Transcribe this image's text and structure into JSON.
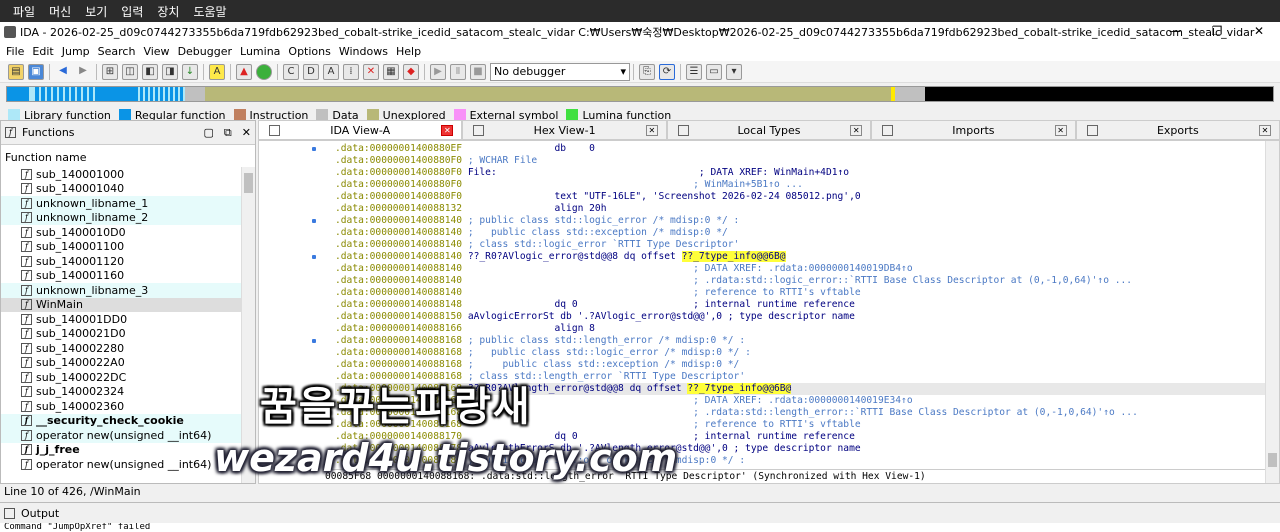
{
  "os_menu": [
    "파일",
    "머신",
    "보기",
    "입력",
    "장치",
    "도움말"
  ],
  "title": "IDA - 2026-02-25_d09c0744273355b6da719fdb62923bed_cobalt-strike_icedid_satacom_stealc_vidar C:₩Users₩숙정₩Desktop₩2026-02-25_d09c0744273355b6da719fdb62923bed_cobalt-strike_icedid_satacom_stealc_vidar",
  "menu": [
    "File",
    "Edit",
    "Jump",
    "Search",
    "View",
    "Debugger",
    "Lumina",
    "Options",
    "Windows",
    "Help"
  ],
  "debugger": "No debugger",
  "legend": [
    {
      "label": "Library function",
      "color": "#aee8f8"
    },
    {
      "label": "Regular function",
      "color": "#0a94e6"
    },
    {
      "label": "Instruction",
      "color": "#c08060"
    },
    {
      "label": "Data",
      "color": "#c0c0c0"
    },
    {
      "label": "Unexplored",
      "color": "#b8b878"
    },
    {
      "label": "External symbol",
      "color": "#f890f8"
    },
    {
      "label": "Lumina function",
      "color": "#40e040"
    }
  ],
  "functions": {
    "title": "Functions",
    "column": "Function name",
    "items": [
      {
        "name": "sub_140001000",
        "type": "reg"
      },
      {
        "name": "sub_140001040",
        "type": "reg"
      },
      {
        "name": "unknown_libname_1",
        "type": "lib"
      },
      {
        "name": "unknown_libname_2",
        "type": "lib"
      },
      {
        "name": "sub_1400010D0",
        "type": "reg"
      },
      {
        "name": "sub_140001100",
        "type": "reg"
      },
      {
        "name": "sub_140001120",
        "type": "reg"
      },
      {
        "name": "sub_140001160",
        "type": "reg"
      },
      {
        "name": "unknown_libname_3",
        "type": "lib"
      },
      {
        "name": "WinMain",
        "type": "sel"
      },
      {
        "name": "sub_140001DD0",
        "type": "reg"
      },
      {
        "name": "sub_1400021D0",
        "type": "reg"
      },
      {
        "name": "sub_140002280",
        "type": "reg"
      },
      {
        "name": "sub_1400022A0",
        "type": "reg"
      },
      {
        "name": "sub_1400022DC",
        "type": "reg"
      },
      {
        "name": "sub_140002324",
        "type": "reg"
      },
      {
        "name": "sub_140002360",
        "type": "reg"
      },
      {
        "name": "__security_check_cookie",
        "type": "libbold"
      },
      {
        "name": "operator new(unsigned __int64)",
        "type": "lib"
      },
      {
        "name": "j_j_free",
        "type": "bold"
      },
      {
        "name": "operator new(unsigned __int64)",
        "type": "reg"
      }
    ]
  },
  "tabs": [
    "IDA View-A",
    "Hex View-1",
    "Local Types",
    "Imports",
    "Exports"
  ],
  "code": [
    {
      "addr": ".data:00000001400880EF",
      "body": "                db    0",
      "hl": false
    },
    {
      "addr": ".data:00000001400880F0",
      "body": " ; WCHAR File",
      "hl": false
    },
    {
      "addr": ".data:00000001400880F0",
      "body": " File:                                   ; DATA XREF: WinMain+4D1↑o",
      "hl": false
    },
    {
      "addr": ".data:00000001400880F0",
      "body": "                                        ; WinMain+5B1↑o ...",
      "hl": false
    },
    {
      "addr": ".data:00000001400880F0",
      "body": "                text \"UTF-16LE\", 'Screenshot 2026-02-24 085012.png',0",
      "hl": false
    },
    {
      "addr": ".data:0000000140088132",
      "body": "                align 20h",
      "hl": false
    },
    {
      "addr": ".data:0000000140088140",
      "body": " ; public class std::logic_error /* mdisp:0 */ :",
      "hl": false
    },
    {
      "addr": ".data:0000000140088140",
      "body": " ;   public class std::exception /* mdisp:0 */",
      "hl": false
    },
    {
      "addr": ".data:0000000140088140",
      "body": " ; class std::logic_error `RTTI Type Descriptor'",
      "hl": false
    },
    {
      "addr": ".data:0000000140088140",
      "body": " ??_R0?AVlogic_error@std@@8 dq offset ??_7type_info@@6B@",
      "hl": false
    },
    {
      "addr": ".data:0000000140088140",
      "body": "                                        ; DATA XREF: .rdata:0000000140019DB4↑o",
      "hl": false
    },
    {
      "addr": ".data:0000000140088140",
      "body": "                                        ; .rdata:std::logic_error::`RTTI Base Class Descriptor at (0,-1,0,64)'↑o ...",
      "hl": false
    },
    {
      "addr": ".data:0000000140088140",
      "body": "                                        ; reference to RTTI's vftable",
      "hl": false
    },
    {
      "addr": ".data:0000000140088148",
      "body": "                dq 0                    ; internal runtime reference",
      "hl": false
    },
    {
      "addr": ".data:0000000140088150",
      "body": " aAvlogicErrorSt db '.?AVlogic_error@std@@',0 ; type descriptor name",
      "hl": false
    },
    {
      "addr": ".data:0000000140088166",
      "body": "                align 8",
      "hl": false
    },
    {
      "addr": ".data:0000000140088168",
      "body": " ; public class std::length_error /* mdisp:0 */ :",
      "hl": false
    },
    {
      "addr": ".data:0000000140088168",
      "body": " ;   public class std::logic_error /* mdisp:0 */ :",
      "hl": false
    },
    {
      "addr": ".data:0000000140088168",
      "body": " ;     public class std::exception /* mdisp:0 */",
      "hl": false
    },
    {
      "addr": ".data:0000000140088168",
      "body": " ; class std::length_error `RTTI Type Descriptor'",
      "hl": false
    },
    {
      "addr": ".data:0000000140088168",
      "body": " ??_R0?AVlength_error@std@@8 dq offset ??_7type_info@@6B@",
      "hl": true
    },
    {
      "addr": ".data:0000000140088168",
      "body": "                                        ; DATA XREF: .rdata:0000000140019E34↑o",
      "hl": false
    },
    {
      "addr": ".data:0000000140088168",
      "body": "                                        ; .rdata:std::length_error::`RTTI Base Class Descriptor at (0,-1,0,64)'↑o ...",
      "hl": false
    },
    {
      "addr": ".data:0000000140088168",
      "body": "                                        ; reference to RTTI's vftable",
      "hl": false
    },
    {
      "addr": ".data:0000000140088170",
      "body": "                dq 0                    ; internal runtime reference",
      "hl": false
    },
    {
      "addr": ".data:0000000140088178",
      "body": " aAvlengthErrorS db '.?AVlength_error@std@@',0 ; type descriptor name",
      "hl": false
    },
    {
      "addr": ".data:000000014008818F",
      "body": " ; public class std::out_of_range /* mdisp:0 */ :",
      "hl": false
    }
  ],
  "sync": "00085F68 0000000140088168: .data:std::length_error `RTTI Type Descriptor' (Synchronized with Hex View-1)",
  "status": "Line 10 of 426, /WinMain",
  "output": {
    "title": "Output",
    "text": "Command \"JumpOpXref\" failed"
  },
  "watermark1": "꿈을꾸는파랑새",
  "watermark2": "wezard4u.tistory.com"
}
